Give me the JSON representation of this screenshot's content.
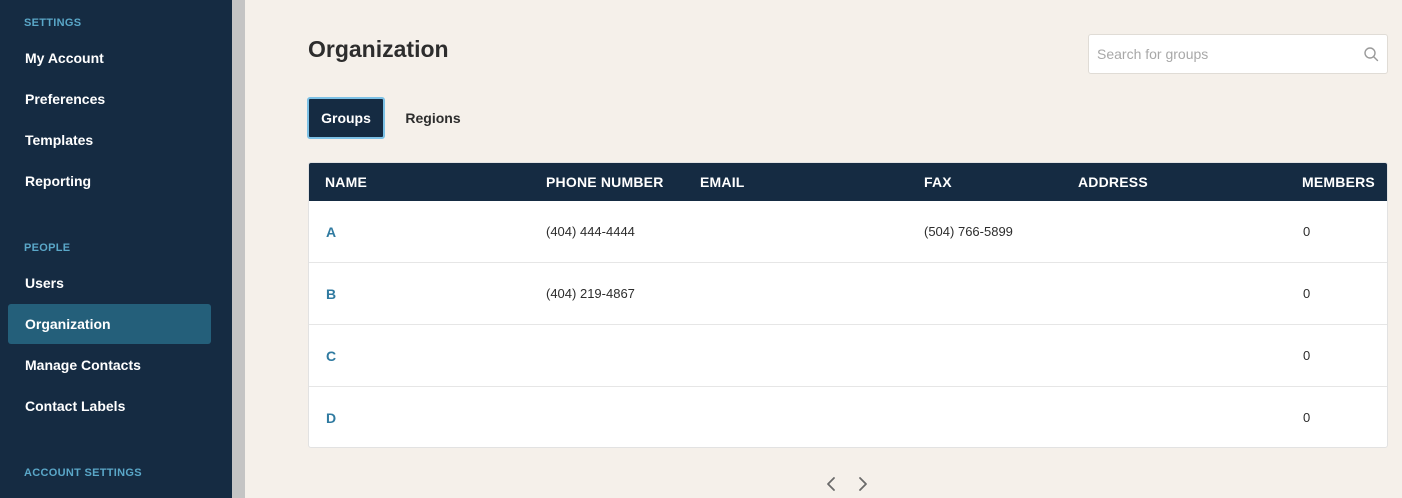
{
  "sidebar": {
    "sections": [
      {
        "heading": "SETTINGS",
        "items": [
          "My Account",
          "Preferences",
          "Templates",
          "Reporting"
        ]
      },
      {
        "heading": "PEOPLE",
        "items": [
          "Users",
          "Organization",
          "Manage Contacts",
          "Contact Labels"
        ]
      },
      {
        "heading": "ACCOUNT SETTINGS",
        "items": []
      }
    ],
    "active_item": "Organization"
  },
  "main": {
    "title": "Organization",
    "search": {
      "placeholder": "Search for groups",
      "value": ""
    },
    "tabs": [
      {
        "label": "Groups",
        "active": true
      },
      {
        "label": "Regions",
        "active": false
      }
    ],
    "table": {
      "columns": [
        "NAME",
        "PHONE NUMBER",
        "EMAIL",
        "FAX",
        "ADDRESS",
        "MEMBERS"
      ],
      "rows": [
        {
          "name": "A",
          "phone": "(404) 444-4444",
          "email": "",
          "fax": "(504) 766-5899",
          "address": "",
          "members": "0"
        },
        {
          "name": "B",
          "phone": "(404) 219-4867",
          "email": "",
          "fax": "",
          "address": "",
          "members": "0"
        },
        {
          "name": "C",
          "phone": "",
          "email": "",
          "fax": "",
          "address": "",
          "members": "0"
        },
        {
          "name": "D",
          "phone": "",
          "email": "",
          "fax": "",
          "address": "",
          "members": "0"
        }
      ]
    }
  },
  "colors": {
    "sidebar_bg": "#152b42",
    "active_nav_bg": "#245f7a",
    "section_heading": "#5aa7c8",
    "page_bg": "#f5f0ea",
    "link": "#2f7aa0"
  }
}
